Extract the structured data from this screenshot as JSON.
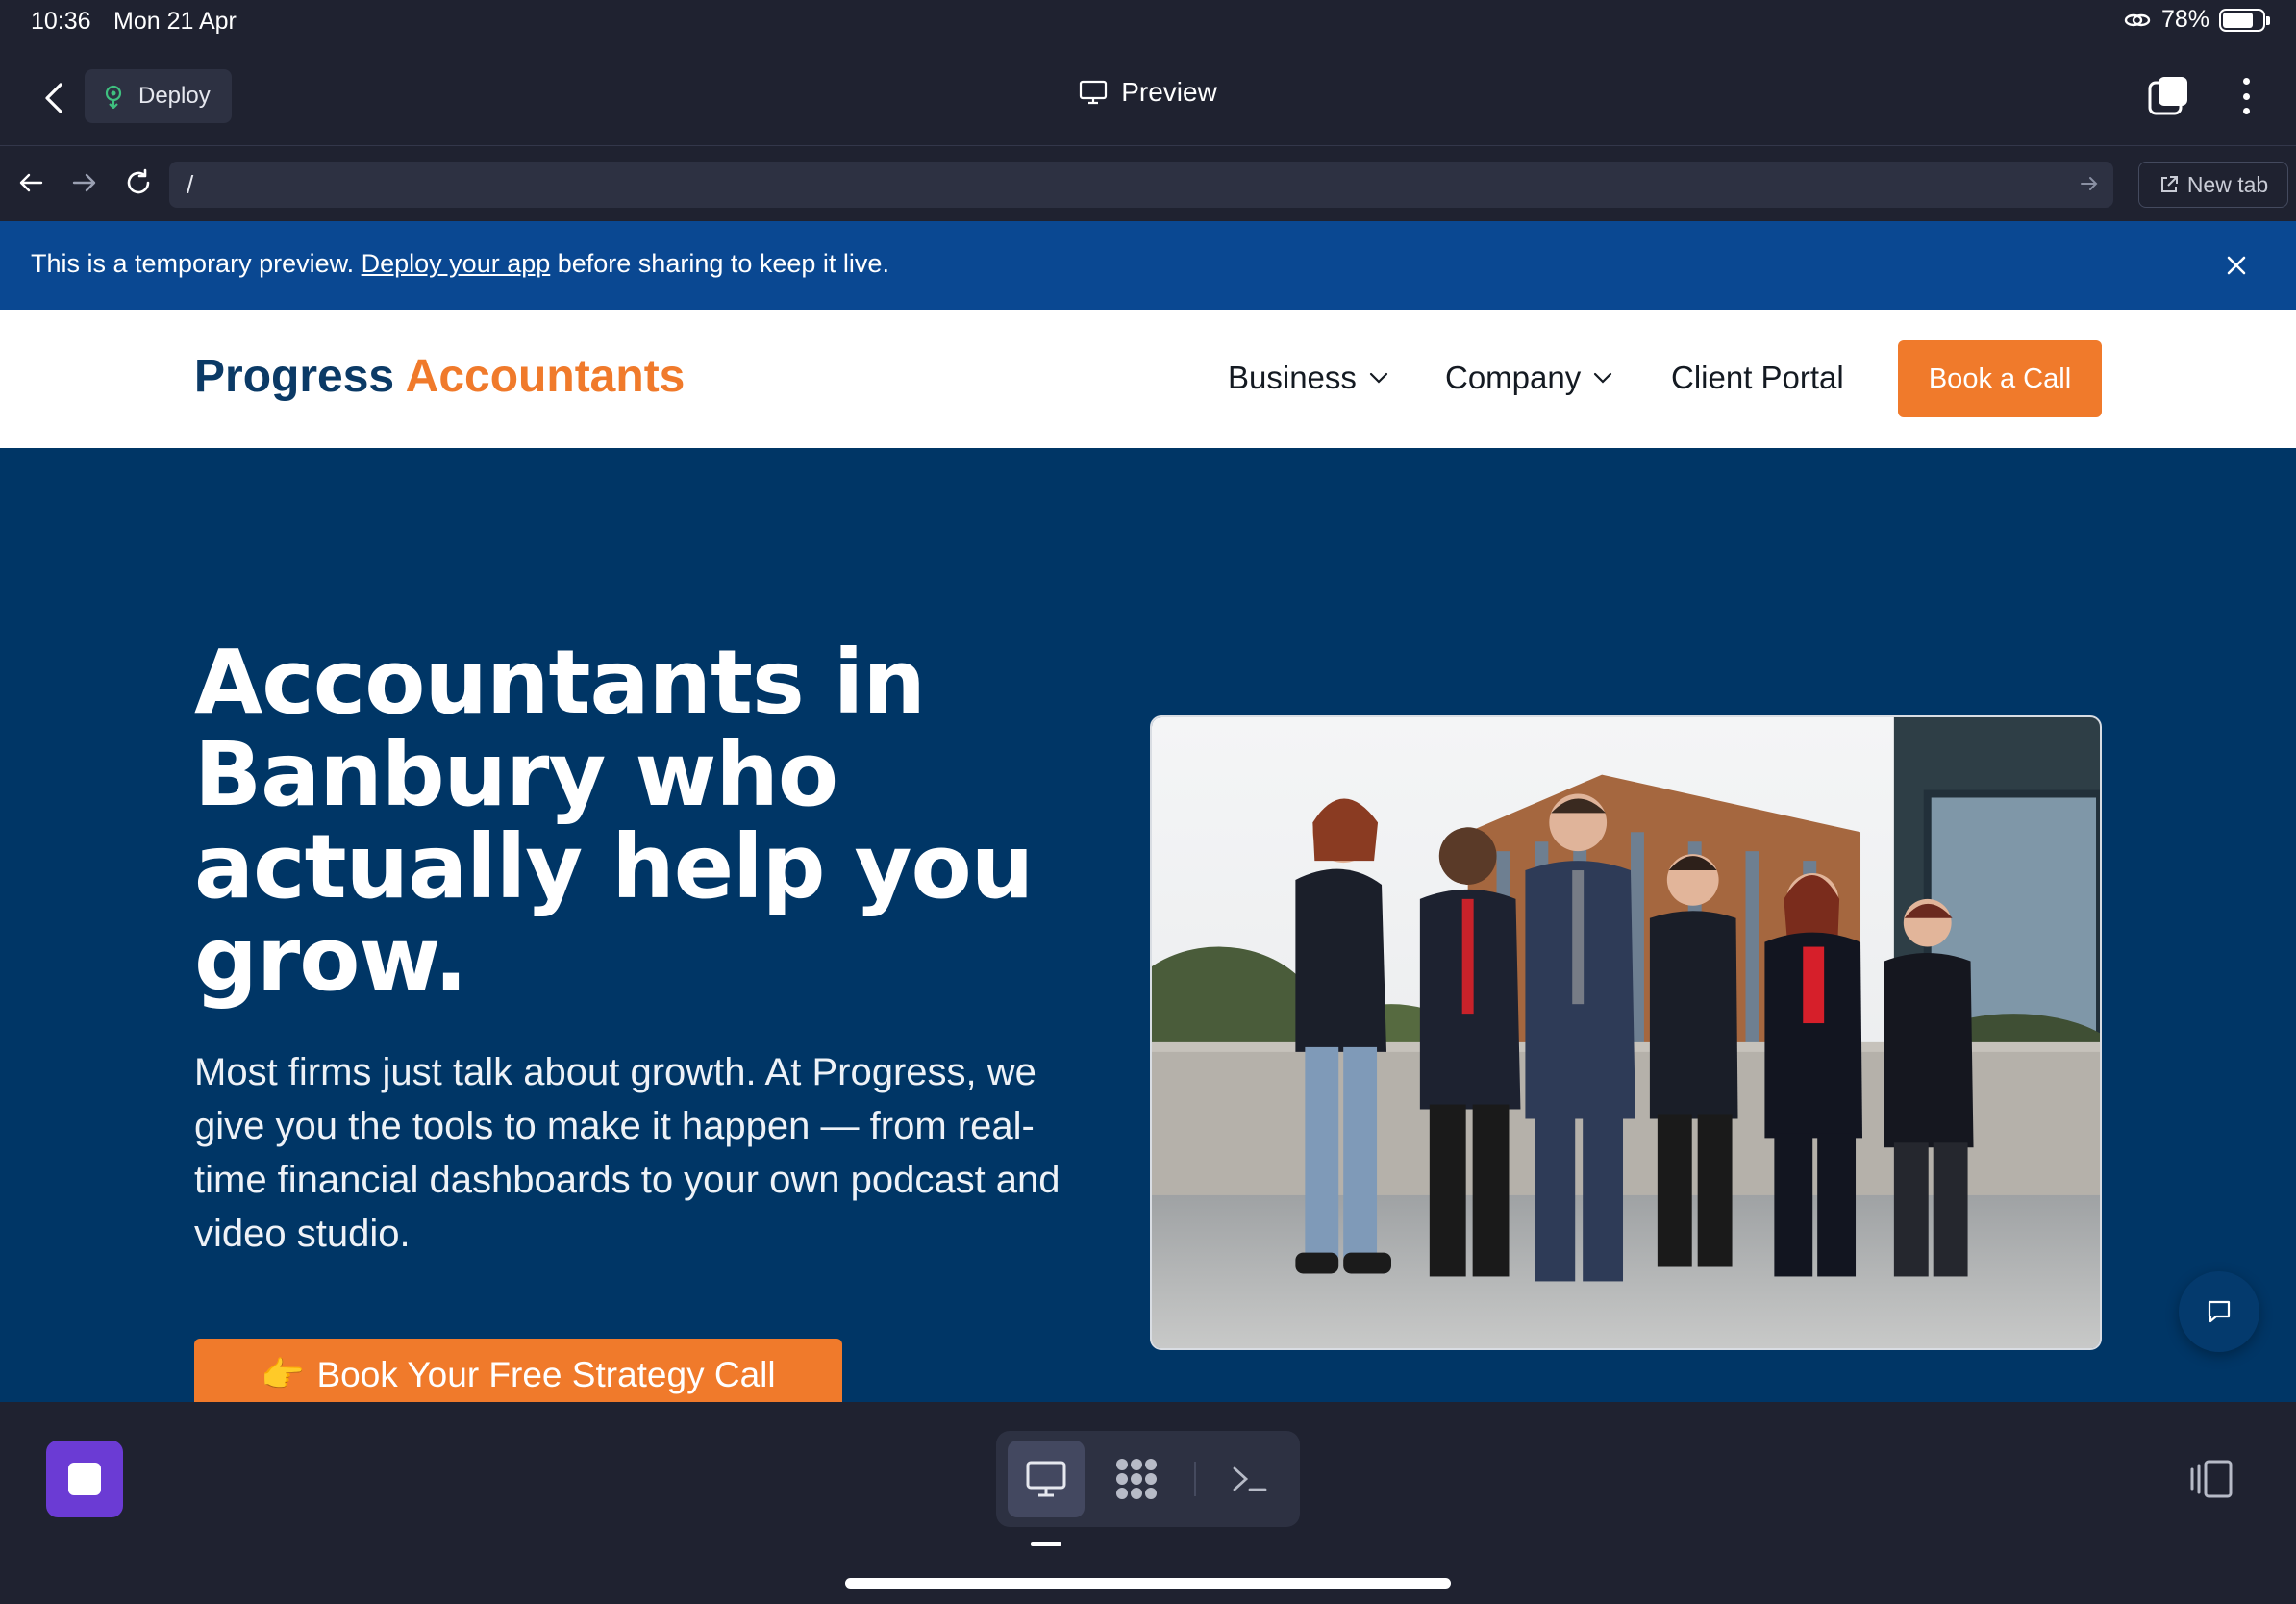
{
  "status_bar": {
    "time": "10:36",
    "date": "Mon 21 Apr",
    "battery": "78%",
    "battery_level": 0.78
  },
  "app_header": {
    "deploy_label": "Deploy",
    "title": "Preview"
  },
  "url_bar": {
    "path": "/",
    "new_tab_label": "New tab"
  },
  "notice": {
    "prefix": "This is a temporary preview. ",
    "link": "Deploy your app",
    "suffix": " before sharing to keep it live."
  },
  "site": {
    "logo_primary": "Progress",
    "logo_accent": "Accountants",
    "nav": {
      "business": "Business",
      "company": "Company",
      "client_portal": "Client Portal",
      "book_call": "Book a Call"
    },
    "hero": {
      "title": "Accountants in Banbury who actually help you grow.",
      "subtitle": "Most firms just talk about growth. At Progress, we give you the tools to make it happen — from real-time financial dashboards to your own podcast and video studio.",
      "cta_emoji": "👉",
      "cta_label": "Book Your Free Strategy Call"
    }
  },
  "colors": {
    "brand_navy": "#003666",
    "brand_orange": "#f07a2b",
    "notice_blue": "#0a4892",
    "app_bg": "#1f2230",
    "stop_purple": "#6b3bd4"
  }
}
